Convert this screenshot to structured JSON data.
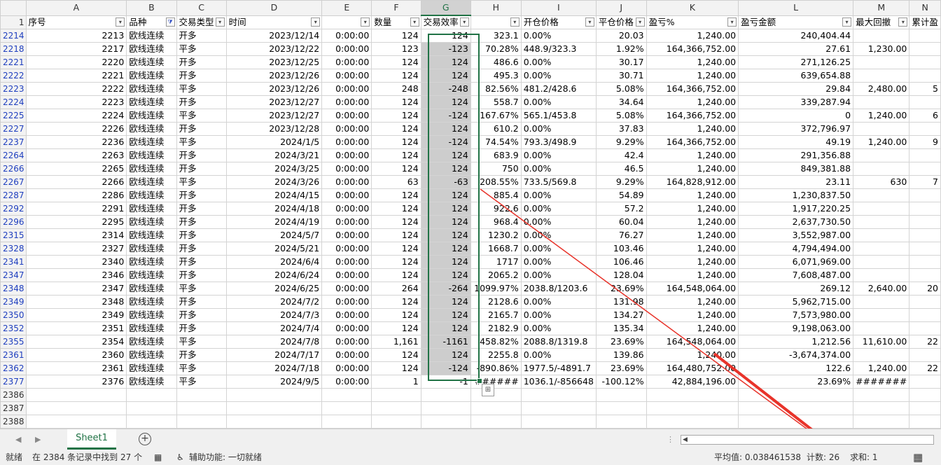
{
  "columns": [
    "A",
    "B",
    "C",
    "D",
    "E",
    "F",
    "G",
    "H",
    "I",
    "J",
    "K",
    "L",
    "M",
    "N"
  ],
  "header_row_num": "1",
  "headers": [
    "序号",
    "品种",
    "交易类型",
    "时间",
    "",
    "数量",
    "交易效率",
    "",
    "开仓价格",
    "平仓价格",
    "盈亏%",
    "盈亏金额",
    "最大回撤",
    "累计盈"
  ],
  "rows": [
    {
      "n": "2214",
      "a": "2213",
      "b": "欧线连续",
      "c": "开多",
      "d": "2023/12/14",
      "e": "0:00:00",
      "f": "124",
      "g": "124",
      "h": "323.1",
      "i": "0.00%",
      "j": "20.03",
      "k": "1,240.00",
      "l": "240,404.44",
      "m": "",
      "x": ""
    },
    {
      "n": "2218",
      "a": "2217",
      "b": "欧线连续",
      "c": "平多",
      "d": "2023/12/22",
      "e": "0:00:00",
      "f": "123",
      "g": "-123",
      "h": "70.28%",
      "i": "448.9/323.3",
      "j": "1.92%",
      "k": "164,366,752.00",
      "l": "27.61",
      "m": "1,230.00",
      "x": ""
    },
    {
      "n": "2221",
      "a": "2220",
      "b": "欧线连续",
      "c": "开多",
      "d": "2023/12/25",
      "e": "0:00:00",
      "f": "124",
      "g": "124",
      "h": "486.6",
      "i": "0.00%",
      "j": "30.17",
      "k": "1,240.00",
      "l": "271,126.25",
      "m": "",
      "x": ""
    },
    {
      "n": "2222",
      "a": "2221",
      "b": "欧线连续",
      "c": "开多",
      "d": "2023/12/26",
      "e": "0:00:00",
      "f": "124",
      "g": "124",
      "h": "495.3",
      "i": "0.00%",
      "j": "30.71",
      "k": "1,240.00",
      "l": "639,654.88",
      "m": "",
      "x": ""
    },
    {
      "n": "2223",
      "a": "2222",
      "b": "欧线连续",
      "c": "平多",
      "d": "2023/12/26",
      "e": "0:00:00",
      "f": "248",
      "g": "-248",
      "h": "82.56%",
      "i": "481.2/428.6",
      "j": "5.08%",
      "k": "164,366,752.00",
      "l": "29.84",
      "m": "2,480.00",
      "x": "5"
    },
    {
      "n": "2224",
      "a": "2223",
      "b": "欧线连续",
      "c": "开多",
      "d": "2023/12/27",
      "e": "0:00:00",
      "f": "124",
      "g": "124",
      "h": "558.7",
      "i": "0.00%",
      "j": "34.64",
      "k": "1,240.00",
      "l": "339,287.94",
      "m": "",
      "x": ""
    },
    {
      "n": "2225",
      "a": "2224",
      "b": "欧线连续",
      "c": "平多",
      "d": "2023/12/27",
      "e": "0:00:00",
      "f": "124",
      "g": "-124",
      "h": "167.67%",
      "i": "565.1/453.8",
      "j": "5.08%",
      "k": "164,366,752.00",
      "l": "0",
      "m": "1,240.00",
      "x": "6"
    },
    {
      "n": "2227",
      "a": "2226",
      "b": "欧线连续",
      "c": "开多",
      "d": "2023/12/28",
      "e": "0:00:00",
      "f": "124",
      "g": "124",
      "h": "610.2",
      "i": "0.00%",
      "j": "37.83",
      "k": "1,240.00",
      "l": "372,796.97",
      "m": "",
      "x": ""
    },
    {
      "n": "2237",
      "a": "2236",
      "b": "欧线连续",
      "c": "平多",
      "d": "2024/1/5",
      "e": "0:00:00",
      "f": "124",
      "g": "-124",
      "h": "74.54%",
      "i": "793.3/498.9",
      "j": "9.29%",
      "k": "164,366,752.00",
      "l": "49.19",
      "m": "1,240.00",
      "x": "9"
    },
    {
      "n": "2264",
      "a": "2263",
      "b": "欧线连续",
      "c": "开多",
      "d": "2024/3/21",
      "e": "0:00:00",
      "f": "124",
      "g": "124",
      "h": "683.9",
      "i": "0.00%",
      "j": "42.4",
      "k": "1,240.00",
      "l": "291,356.88",
      "m": "",
      "x": ""
    },
    {
      "n": "2266",
      "a": "2265",
      "b": "欧线连续",
      "c": "开多",
      "d": "2024/3/25",
      "e": "0:00:00",
      "f": "124",
      "g": "124",
      "h": "750",
      "i": "0.00%",
      "j": "46.5",
      "k": "1,240.00",
      "l": "849,381.88",
      "m": "",
      "x": ""
    },
    {
      "n": "2267",
      "a": "2266",
      "b": "欧线连续",
      "c": "平多",
      "d": "2024/3/26",
      "e": "0:00:00",
      "f": "63",
      "g": "-63",
      "h": "208.55%",
      "i": "733.5/569.8",
      "j": "9.29%",
      "k": "164,828,912.00",
      "l": "23.11",
      "m": "630",
      "x": "7"
    },
    {
      "n": "2287",
      "a": "2286",
      "b": "欧线连续",
      "c": "开多",
      "d": "2024/4/15",
      "e": "0:00:00",
      "f": "124",
      "g": "124",
      "h": "885.4",
      "i": "0.00%",
      "j": "54.89",
      "k": "1,240.00",
      "l": "1,230,837.50",
      "m": "",
      "x": ""
    },
    {
      "n": "2292",
      "a": "2291",
      "b": "欧线连续",
      "c": "开多",
      "d": "2024/4/18",
      "e": "0:00:00",
      "f": "124",
      "g": "124",
      "h": "922.6",
      "i": "0.00%",
      "j": "57.2",
      "k": "1,240.00",
      "l": "1,917,220.25",
      "m": "",
      "x": ""
    },
    {
      "n": "2296",
      "a": "2295",
      "b": "欧线连续",
      "c": "开多",
      "d": "2024/4/19",
      "e": "0:00:00",
      "f": "124",
      "g": "124",
      "h": "968.4",
      "i": "0.00%",
      "j": "60.04",
      "k": "1,240.00",
      "l": "2,637,730.50",
      "m": "",
      "x": ""
    },
    {
      "n": "2315",
      "a": "2314",
      "b": "欧线连续",
      "c": "开多",
      "d": "2024/5/7",
      "e": "0:00:00",
      "f": "124",
      "g": "124",
      "h": "1230.2",
      "i": "0.00%",
      "j": "76.27",
      "k": "1,240.00",
      "l": "3,552,987.00",
      "m": "",
      "x": ""
    },
    {
      "n": "2328",
      "a": "2327",
      "b": "欧线连续",
      "c": "开多",
      "d": "2024/5/21",
      "e": "0:00:00",
      "f": "124",
      "g": "124",
      "h": "1668.7",
      "i": "0.00%",
      "j": "103.46",
      "k": "1,240.00",
      "l": "4,794,494.00",
      "m": "",
      "x": ""
    },
    {
      "n": "2341",
      "a": "2340",
      "b": "欧线连续",
      "c": "开多",
      "d": "2024/6/4",
      "e": "0:00:00",
      "f": "124",
      "g": "124",
      "h": "1717",
      "i": "0.00%",
      "j": "106.46",
      "k": "1,240.00",
      "l": "6,071,969.00",
      "m": "",
      "x": ""
    },
    {
      "n": "2347",
      "a": "2346",
      "b": "欧线连续",
      "c": "开多",
      "d": "2024/6/24",
      "e": "0:00:00",
      "f": "124",
      "g": "124",
      "h": "2065.2",
      "i": "0.00%",
      "j": "128.04",
      "k": "1,240.00",
      "l": "7,608,487.00",
      "m": "",
      "x": ""
    },
    {
      "n": "2348",
      "a": "2347",
      "b": "欧线连续",
      "c": "平多",
      "d": "2024/6/25",
      "e": "0:00:00",
      "f": "264",
      "g": "-264",
      "h": "1099.97%",
      "i": "2038.8/1203.6",
      "j": "23.69%",
      "k": "164,548,064.00",
      "l": "269.12",
      "m": "2,640.00",
      "x": "20"
    },
    {
      "n": "2349",
      "a": "2348",
      "b": "欧线连续",
      "c": "开多",
      "d": "2024/7/2",
      "e": "0:00:00",
      "f": "124",
      "g": "124",
      "h": "2128.6",
      "i": "0.00%",
      "j": "131.98",
      "k": "1,240.00",
      "l": "5,962,715.00",
      "m": "",
      "x": ""
    },
    {
      "n": "2350",
      "a": "2349",
      "b": "欧线连续",
      "c": "开多",
      "d": "2024/7/3",
      "e": "0:00:00",
      "f": "124",
      "g": "124",
      "h": "2165.7",
      "i": "0.00%",
      "j": "134.27",
      "k": "1,240.00",
      "l": "7,573,980.00",
      "m": "",
      "x": ""
    },
    {
      "n": "2352",
      "a": "2351",
      "b": "欧线连续",
      "c": "开多",
      "d": "2024/7/4",
      "e": "0:00:00",
      "f": "124",
      "g": "124",
      "h": "2182.9",
      "i": "0.00%",
      "j": "135.34",
      "k": "1,240.00",
      "l": "9,198,063.00",
      "m": "",
      "x": ""
    },
    {
      "n": "2355",
      "a": "2354",
      "b": "欧线连续",
      "c": "平多",
      "d": "2024/7/8",
      "e": "0:00:00",
      "f": "1,161",
      "g": "-1161",
      "h": "458.82%",
      "i": "2088.8/1319.8",
      "j": "23.69%",
      "k": "164,548,064.00",
      "l": "1,212.56",
      "m": "11,610.00",
      "x": "22"
    },
    {
      "n": "2361",
      "a": "2360",
      "b": "欧线连续",
      "c": "开多",
      "d": "2024/7/17",
      "e": "0:00:00",
      "f": "124",
      "g": "124",
      "h": "2255.8",
      "i": "0.00%",
      "j": "139.86",
      "k": "1,240.00",
      "l": "-3,674,374.00",
      "m": "",
      "x": ""
    },
    {
      "n": "2362",
      "a": "2361",
      "b": "欧线连续",
      "c": "平多",
      "d": "2024/7/18",
      "e": "0:00:00",
      "f": "124",
      "g": "-124",
      "h": "-890.86%",
      "i": "1977.5/-4891.7",
      "j": "23.69%",
      "k": "164,480,752.00",
      "l": "122.6",
      "m": "1,240.00",
      "x": "22"
    },
    {
      "n": "2377",
      "a": "2376",
      "b": "欧线连续",
      "c": "平多",
      "d": "2024/9/5",
      "e": "0:00:00",
      "f": "1",
      "g": "-1",
      "h": "######",
      "i": "1036.1/-856648",
      "j": "-100.12%",
      "k": "42,884,196.00",
      "l": "23.69%",
      "m": "#######",
      "x": ""
    }
  ],
  "empty_rows": [
    "2386",
    "2387",
    "2388"
  ],
  "sheet_tab": "Sheet1",
  "status": {
    "ready": "就绪",
    "filter_msg": "在 2384 条记录中找到 27 个",
    "accessibility": "辅助功能: 一切就绪",
    "average": "平均值: 0.038461538",
    "count": "计数: 26",
    "sum": "求和: 1"
  },
  "colors": {
    "accent": "#217346",
    "arrow": "#e8332a",
    "row_number_filtered": "#1f3fbf",
    "selection_fill": "#cdcdcd"
  }
}
